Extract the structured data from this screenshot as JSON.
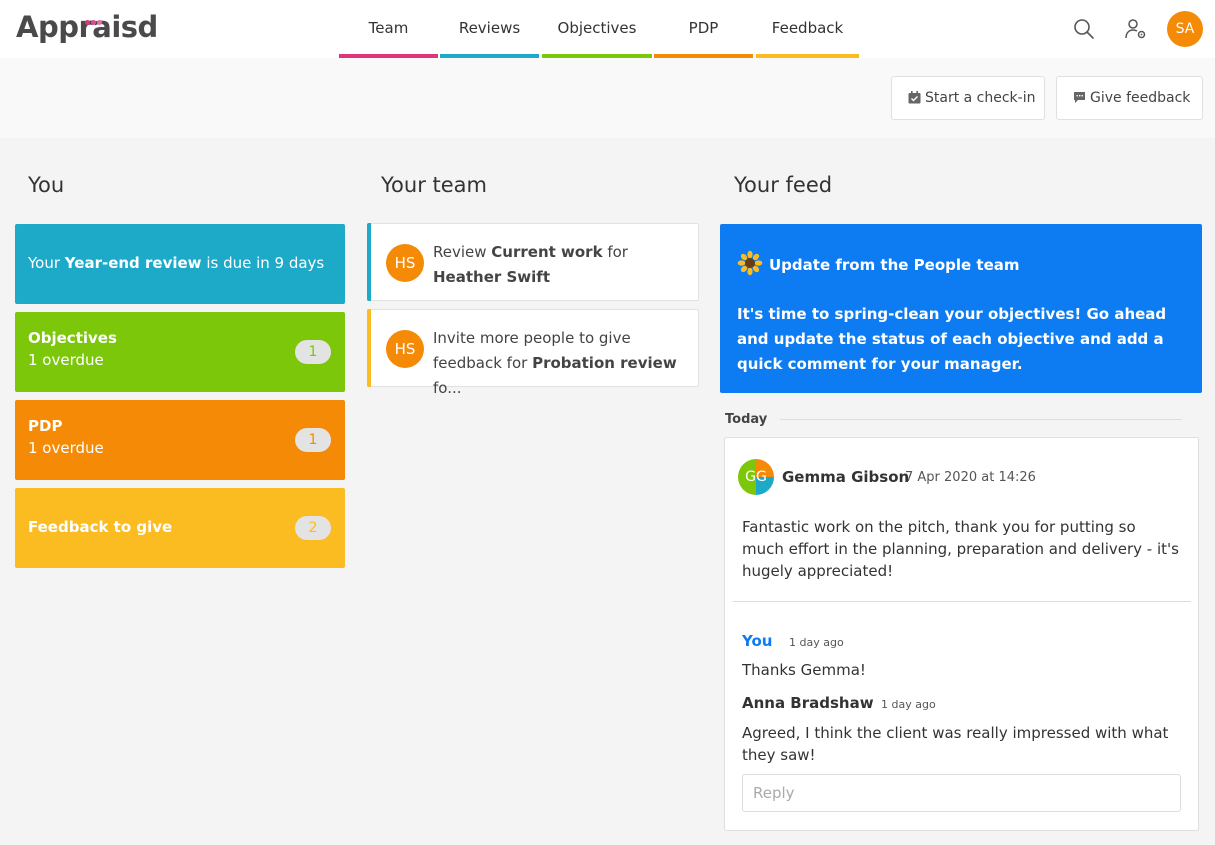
{
  "app": {
    "logo": "Appraisd",
    "logo_dot_colors": [
      "#e83e8c",
      "#d63384",
      "#f06292"
    ]
  },
  "nav": {
    "tabs": [
      {
        "label": "Team",
        "color": "#e0357a"
      },
      {
        "label": "Reviews",
        "color": "#1da9c8"
      },
      {
        "label": "Objectives",
        "color": "#7cc70a"
      },
      {
        "label": "PDP",
        "color": "#f58a07"
      },
      {
        "label": "Feedback",
        "color": "#fbbc22"
      }
    ],
    "search_icon": "search-icon",
    "admin_icon": "user-settings-icon",
    "user_initials": "SA"
  },
  "actions": {
    "checkin_label": "Start a check-in",
    "feedback_label": "Give feedback"
  },
  "columns": {
    "you": "You",
    "team": "Your team",
    "feed": "Your feed"
  },
  "you": {
    "review_prefix": "Your ",
    "review_name": "Year-end review",
    "review_suffix": " is due in 9 days",
    "review_color": "#1da9c8",
    "objectives": {
      "title": "Objectives",
      "status": "1 overdue",
      "count": "1",
      "color": "#7cc70a"
    },
    "pdp": {
      "title": "PDP",
      "status": "1 overdue",
      "count": "1",
      "color": "#f58a07"
    },
    "feedback": {
      "title": "Feedback to give",
      "count": "2",
      "color": "#fbbc22"
    }
  },
  "team": [
    {
      "initials": "HS",
      "pre": "Review ",
      "bold1": "Current work",
      "mid": " for ",
      "bold2": "Heather Swift",
      "post": "",
      "accent": "#1da9c8"
    },
    {
      "initials": "HS",
      "pre": "Invite more people to give feedback for ",
      "bold1": "Probation review",
      "mid": "",
      "bold2": "",
      "post": " fo...",
      "accent": "#fbbc22"
    }
  ],
  "people_update": {
    "icon": "sunflower-icon",
    "title": "Update from the People team",
    "body": "It's time to spring-clean your objectives! Go ahead and update the status of each objective and add a quick comment for your manager.",
    "color": "#0d7cf2"
  },
  "feed": {
    "section": "Today",
    "post": {
      "initials": "GG",
      "author": "Gemma Gibson",
      "date": "7 Apr 2020 at 14:26",
      "message": "Fantastic work on the pitch, thank you for putting so much effort in the planning, preparation and delivery - it's hugely appreciated!"
    },
    "comments": [
      {
        "author": "You",
        "time": "1 day ago",
        "text": "Thanks Gemma!"
      },
      {
        "author": "Anna Bradshaw",
        "time": "1 day ago",
        "text": "Agreed, I think the client was really impressed with what they saw!"
      }
    ],
    "reply_placeholder": "Reply"
  }
}
